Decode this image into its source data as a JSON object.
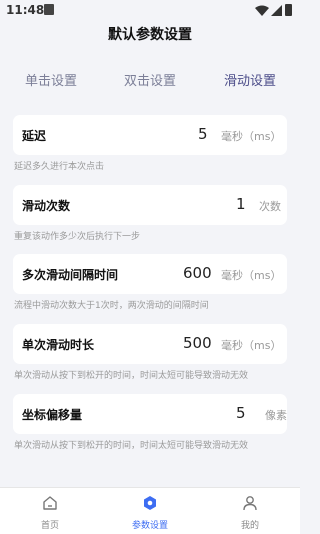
{
  "status": {
    "time": "11:48"
  },
  "header": {
    "title": "默认参数设置"
  },
  "tabs": [
    "单击设置",
    "双击设置",
    "滑动设置"
  ],
  "settings": [
    {
      "label": "延迟",
      "value": "5",
      "unit": "毫秒（ms）",
      "hint": "延迟多久进行本次点击"
    },
    {
      "label": "滑动次数",
      "value": "1",
      "unit": "次数",
      "hint": "重复该动作多少次后执行下一步"
    },
    {
      "label": "多次滑动间隔时间",
      "value": "600",
      "unit": "毫秒（ms）",
      "hint": "流程中滑动次数大于1次时，两次滑动的间隔时间"
    },
    {
      "label": "单次滑动时长",
      "value": "500",
      "unit": "毫秒（ms）",
      "hint": "单次滑动从按下到松开的时间，时间太短可能导致滑动无效"
    },
    {
      "label": "坐标偏移量",
      "value": "5",
      "unit": "像素",
      "hint": "单次滑动从按下到松开的时间，时间太短可能导致滑动无效"
    }
  ],
  "nav": [
    {
      "label": "首页",
      "icon": "home-icon"
    },
    {
      "label": "参数设置",
      "icon": "settings-icon"
    },
    {
      "label": "我的",
      "icon": "user-icon"
    }
  ],
  "colors": {
    "accent": "#3d6df2",
    "active_tab": "#4d4e8a",
    "background": "#f3f4f8"
  }
}
